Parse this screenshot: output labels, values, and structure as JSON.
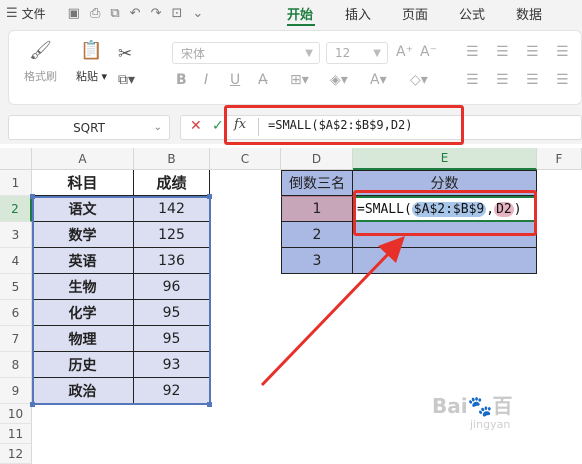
{
  "topbar": {
    "file_label": "文件",
    "tabs": [
      "开始",
      "插入",
      "页面",
      "公式",
      "数据"
    ]
  },
  "ribbon": {
    "format_painter_label": "格式刷",
    "paste_label": "粘贴",
    "font_name": "宋体",
    "font_size": "12"
  },
  "formula_bar": {
    "name_box": "SQRT",
    "fx_label": "fx",
    "formula": "=SMALL($A$2:$B$9,D2)"
  },
  "columns": [
    "A",
    "B",
    "C",
    "D",
    "E",
    "F"
  ],
  "rows": [
    "1",
    "2",
    "3",
    "4",
    "5",
    "6",
    "7",
    "8",
    "9",
    "10",
    "11",
    "12"
  ],
  "table": {
    "header_subject": "科目",
    "header_score": "成绩",
    "rows": [
      {
        "subject": "语文",
        "score": "142"
      },
      {
        "subject": "数学",
        "score": "125"
      },
      {
        "subject": "英语",
        "score": "136"
      },
      {
        "subject": "生物",
        "score": "96"
      },
      {
        "subject": "化学",
        "score": "95"
      },
      {
        "subject": "物理",
        "score": "95"
      },
      {
        "subject": "历史",
        "score": "93"
      },
      {
        "subject": "政治",
        "score": "92"
      }
    ]
  },
  "rank_table": {
    "header_rank": "倒数三名",
    "header_score": "分数",
    "ranks": [
      "1",
      "2",
      "3"
    ],
    "cell_formula_prefix": "=SMALL(",
    "cell_formula_range": "$A$2:$B$9",
    "cell_formula_comma": ",",
    "cell_formula_ref": "D2",
    "cell_formula_suffix": ")"
  },
  "colors": {
    "accent": "#1c7d3f",
    "highlight_red": "#e8302a",
    "table_fill": "#dcdff2",
    "rank_fill": "#a9b9e3"
  }
}
